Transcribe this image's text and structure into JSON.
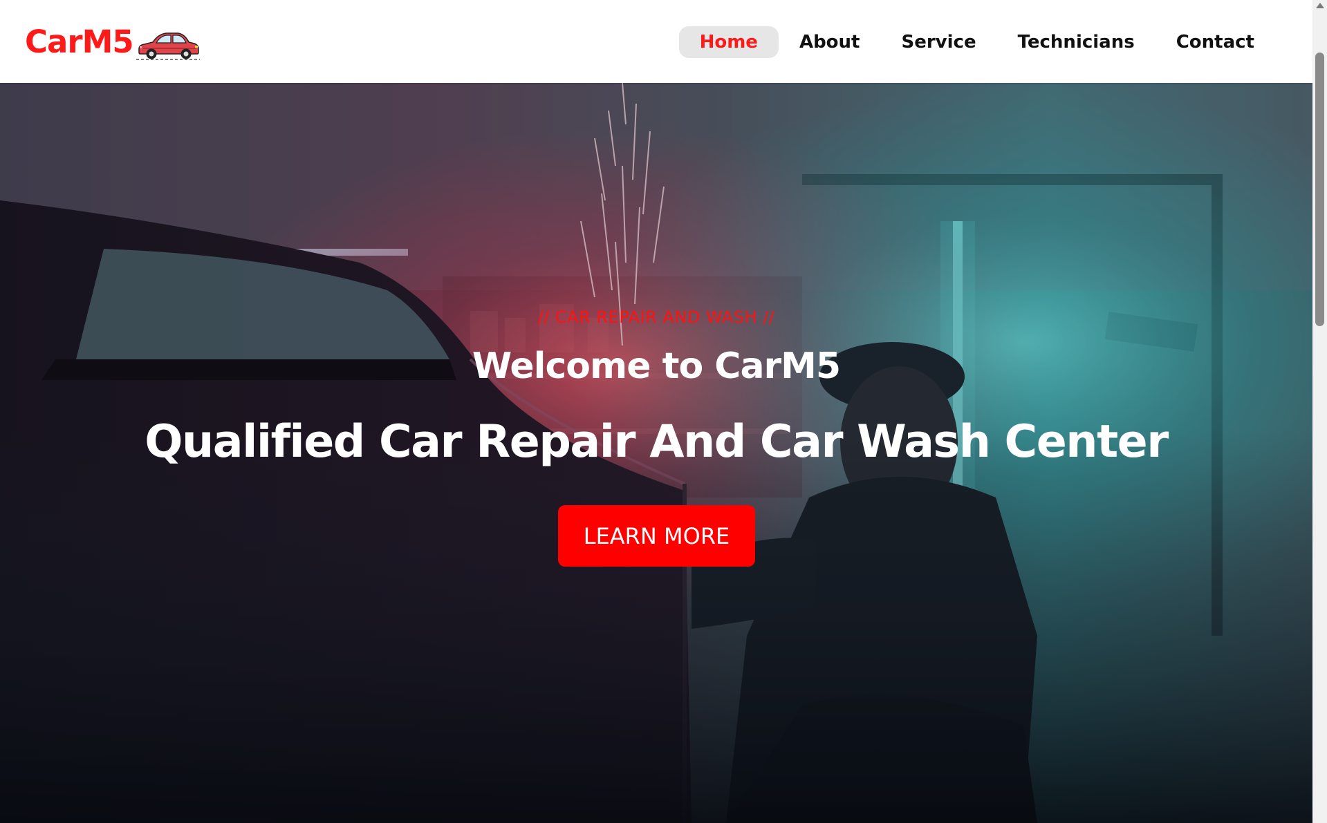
{
  "brand": {
    "name": "CarM5",
    "logo_icon": "car-icon",
    "color": "#ff1a1a"
  },
  "nav": {
    "items": [
      {
        "label": "Home",
        "active": true
      },
      {
        "label": "About",
        "active": false
      },
      {
        "label": "Service",
        "active": false
      },
      {
        "label": "Technicians",
        "active": false
      },
      {
        "label": "Contact",
        "active": false
      }
    ]
  },
  "hero": {
    "tagline": "// CAR REPAIR AND WASH //",
    "welcome": "Welcome to CarM5",
    "title": "Qualified Car Repair And Car Wash Center",
    "button_label": "LEARN MORE",
    "accent_color": "#ff0000"
  }
}
